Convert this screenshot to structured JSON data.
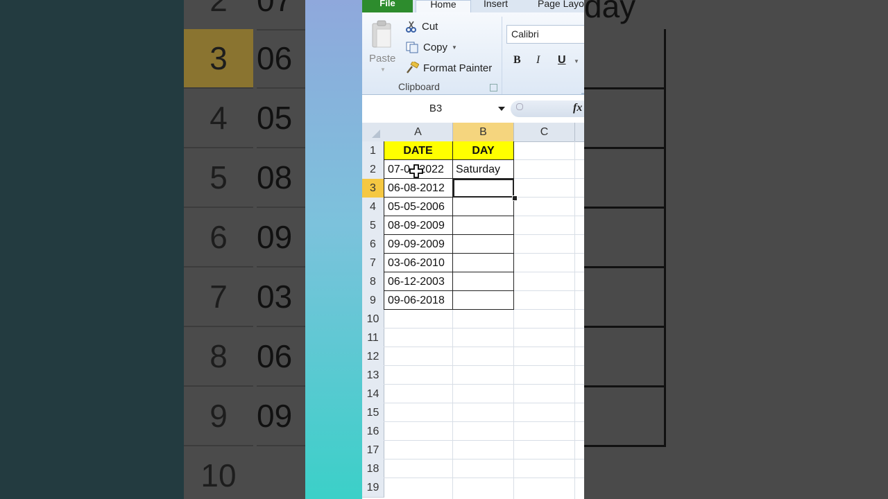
{
  "background": {
    "row_numbers": [
      "2",
      "3",
      "4",
      "5",
      "6",
      "7",
      "8",
      "9",
      "10"
    ],
    "cell_fragments": [
      "07",
      "06",
      "05",
      "08",
      "09",
      "03",
      "06",
      "09"
    ],
    "day_fragment": "day"
  },
  "ribbon": {
    "tabs": {
      "file": "File",
      "home": "Home",
      "insert": "Insert",
      "page_layout": "Page Layo"
    },
    "clipboard": {
      "paste": "Paste",
      "cut": "Cut",
      "copy": "Copy",
      "format_painter": "Format Painter",
      "group_label": "Clipboard"
    },
    "font": {
      "name": "Calibri",
      "bold": "B",
      "italic": "I",
      "underline": "U"
    }
  },
  "formula_bar": {
    "name_box": "B3",
    "fx": "fx",
    "formula": ""
  },
  "sheet": {
    "columns": [
      "A",
      "B",
      "C"
    ],
    "selected_column": "B",
    "selected_row": "3",
    "row_numbers": [
      "1",
      "2",
      "3",
      "4",
      "5",
      "6",
      "7",
      "8",
      "9",
      "10",
      "11",
      "12",
      "13",
      "14",
      "15",
      "16",
      "17",
      "18",
      "19"
    ],
    "header_row": {
      "a": "DATE",
      "b": "DAY"
    },
    "data_rows": [
      {
        "date": "07-05-2022",
        "day": "Saturday"
      },
      {
        "date": "06-08-2012",
        "day": ""
      },
      {
        "date": "05-05-2006",
        "day": ""
      },
      {
        "date": "08-09-2009",
        "day": ""
      },
      {
        "date": "09-09-2009",
        "day": ""
      },
      {
        "date": "03-06-2010",
        "day": ""
      },
      {
        "date": "06-12-2003",
        "day": ""
      },
      {
        "date": "09-06-2018",
        "day": ""
      }
    ],
    "cell_a2_visible": "07-0   2022"
  },
  "colors": {
    "header_fill": "#ffff00",
    "selected_header": "#f5d57e",
    "selected_row_header": "#f5c842",
    "file_tab": "#2d8c2d"
  }
}
